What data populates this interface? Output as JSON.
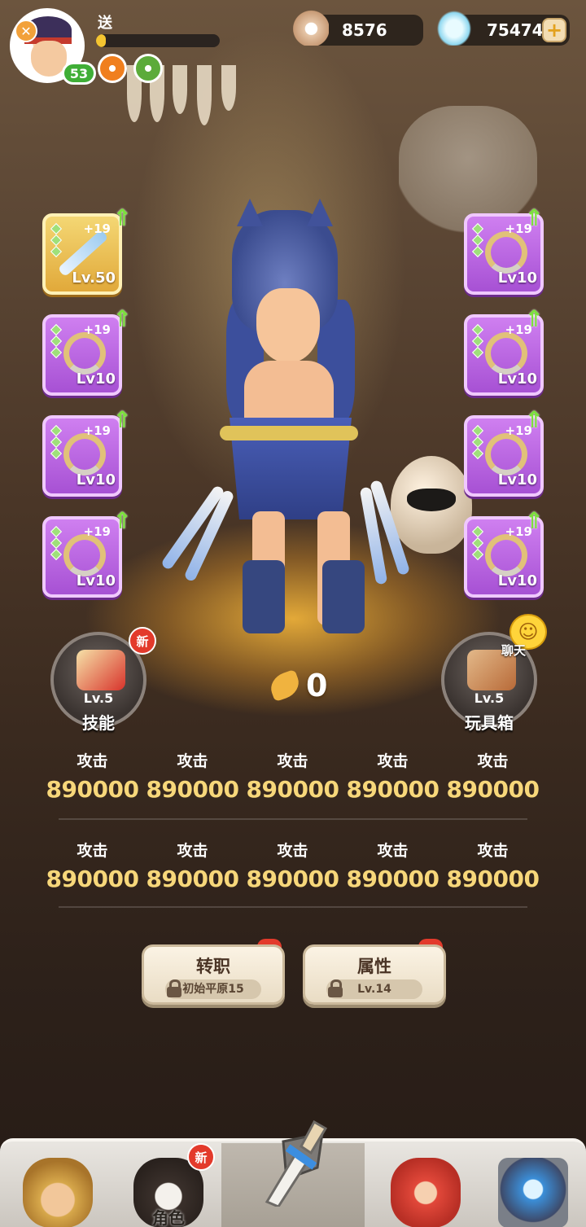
{
  "header": {
    "player_name": "送",
    "player_level": "53",
    "exp_progress": 0.08,
    "x_icon": "crossed-swords-icon",
    "buffs": [
      "fire-buff-icon",
      "leaf-buff-icon"
    ],
    "pearls": "8576",
    "gems": "75474",
    "plus_label": "+"
  },
  "equipment": {
    "left": [
      {
        "plus": "+19",
        "level": "Lv.50",
        "rarity": "gold",
        "icon": "spear-icon"
      },
      {
        "plus": "+19",
        "level": "Lv10",
        "rarity": "purple",
        "icon": "fang-necklace-icon"
      },
      {
        "plus": "+19",
        "level": "Lv10",
        "rarity": "purple",
        "icon": "fang-necklace-icon"
      },
      {
        "plus": "+19",
        "level": "Lv10",
        "rarity": "purple",
        "icon": "fang-necklace-icon"
      }
    ],
    "right": [
      {
        "plus": "+19",
        "level": "Lv10",
        "rarity": "purple",
        "icon": "fang-necklace-icon"
      },
      {
        "plus": "+19",
        "level": "Lv10",
        "rarity": "purple",
        "icon": "fang-necklace-icon"
      },
      {
        "plus": "+19",
        "level": "Lv10",
        "rarity": "purple",
        "icon": "fang-necklace-icon"
      },
      {
        "plus": "+19",
        "level": "Lv10",
        "rarity": "purple",
        "icon": "fang-necklace-icon"
      }
    ],
    "upgrade_arrow": "⇑"
  },
  "skills": {
    "label": "技能",
    "level": "Lv.5",
    "new_badge": "新"
  },
  "toybox": {
    "label": "玩具箱",
    "level": "Lv.5",
    "chat_label": "聊天",
    "smiley": "☺"
  },
  "power": {
    "value": "0"
  },
  "stats": {
    "row1": [
      {
        "label": "攻击",
        "value": "890000"
      },
      {
        "label": "攻击",
        "value": "890000"
      },
      {
        "label": "攻击",
        "value": "890000"
      },
      {
        "label": "攻击",
        "value": "890000"
      },
      {
        "label": "攻击",
        "value": "890000"
      }
    ],
    "row2": [
      {
        "label": "攻击",
        "value": "890000"
      },
      {
        "label": "攻击",
        "value": "890000"
      },
      {
        "label": "攻击",
        "value": "890000"
      },
      {
        "label": "攻击",
        "value": "890000"
      },
      {
        "label": "攻击",
        "value": "890000"
      }
    ]
  },
  "actions": {
    "job_change": {
      "title": "转职",
      "requirement": "初始平原15"
    },
    "attributes": {
      "title": "属性",
      "requirement": "Lv.14"
    }
  },
  "bottom_nav": {
    "items": [
      {
        "label": "",
        "icon": "caveman-icon"
      },
      {
        "label": "角色",
        "icon": "character-icon",
        "badge": "新"
      },
      {
        "label": "",
        "icon": "sword-icon",
        "active": true
      },
      {
        "label": "",
        "icon": "dino-pet-icon"
      },
      {
        "label": "",
        "icon": "portal-icon"
      }
    ]
  },
  "colors": {
    "purple_slot": "#b45fe0",
    "gold_slot": "#e9bd4f",
    "stat_value": "#f7d77a",
    "level_badge": "#3fae36",
    "new_badge": "#e33a2b"
  }
}
